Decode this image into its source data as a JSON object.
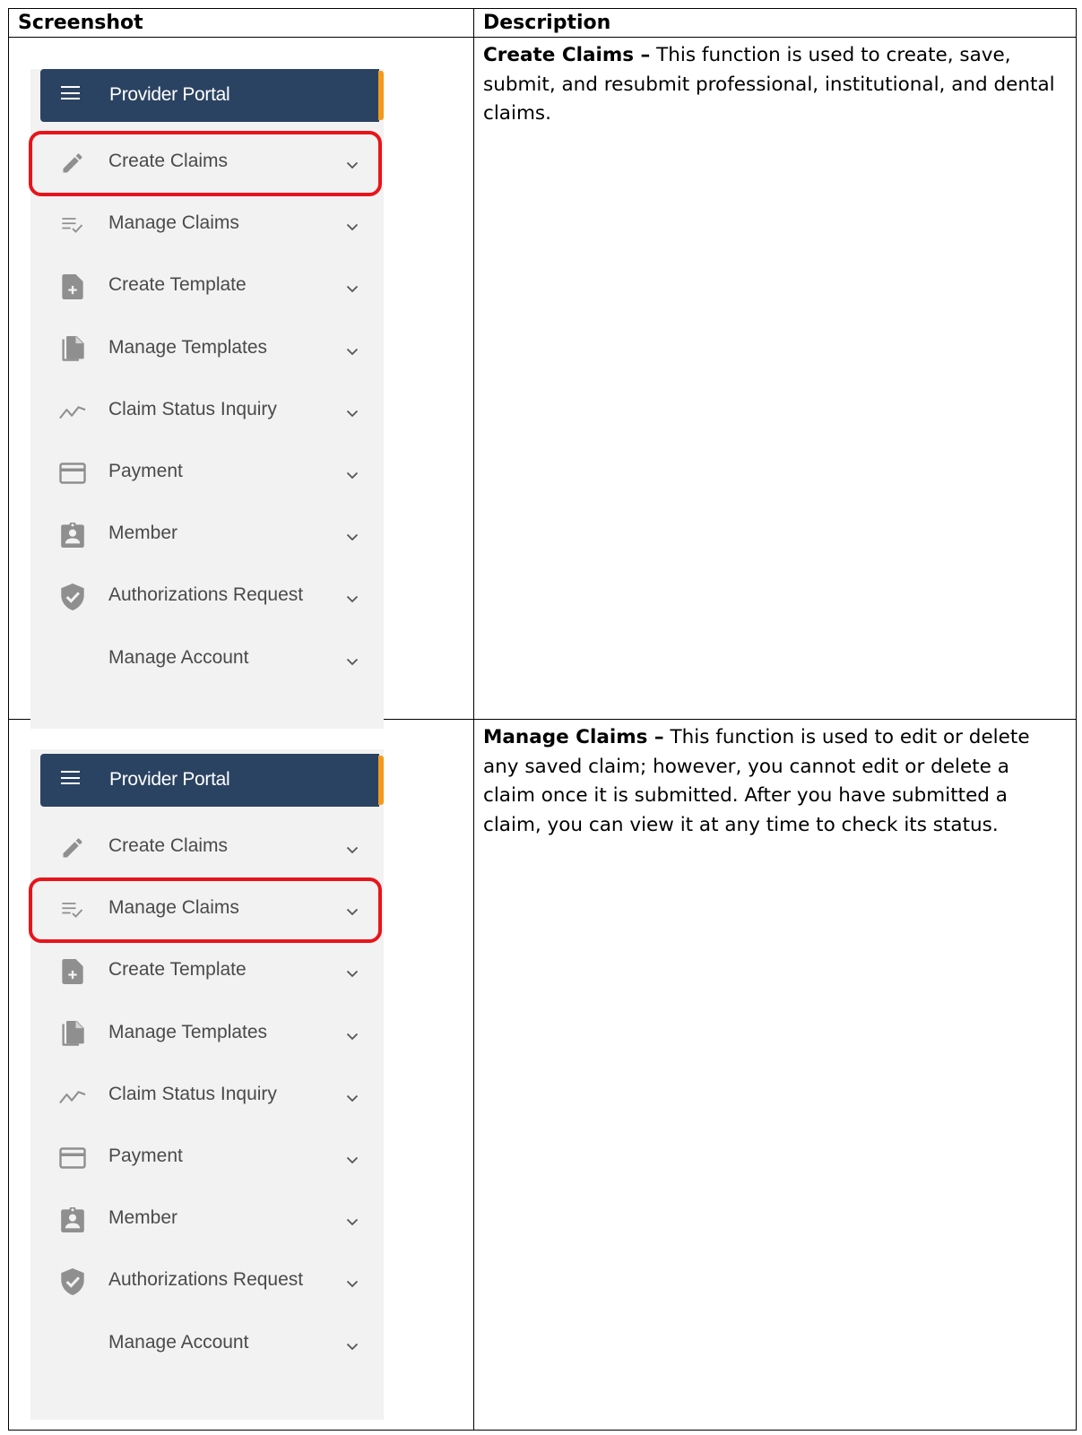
{
  "table": {
    "headers": [
      "Screenshot",
      "Description"
    ]
  },
  "sidebar": {
    "title": "Provider Portal",
    "items": [
      {
        "label": "Create Claims",
        "icon": "pencil-icon"
      },
      {
        "label": "Manage Claims",
        "icon": "list-check-icon"
      },
      {
        "label": "Create Template",
        "icon": "file-plus-icon"
      },
      {
        "label": "Manage Templates",
        "icon": "files-icon"
      },
      {
        "label": "Claim Status Inquiry",
        "icon": "trend-line-icon"
      },
      {
        "label": "Payment",
        "icon": "credit-card-icon"
      },
      {
        "label": "Member",
        "icon": "id-badge-icon"
      },
      {
        "label": "Authorizations Request",
        "icon": "shield-check-icon"
      },
      {
        "label": "Manage Account",
        "icon": ""
      }
    ]
  },
  "rows": [
    {
      "highlighted_item": "Create Claims",
      "title": "Create Claims –",
      "text": " This function is used to create, save, submit, and resubmit professional, institutional, and dental claims."
    },
    {
      "highlighted_item": "Manage Claims",
      "title": "Manage Claims –",
      "text": " This function is used to edit or delete any saved claim; however, you cannot edit or delete a claim once it is submitted. After you have submitted a claim, you can view it at any time to check its status."
    }
  ],
  "colors": {
    "portal_bar": "#2b4362",
    "accent": "#f39a1e",
    "highlight": "#e8141b",
    "panel_bg": "#f2f2f2",
    "icon": "#8f8f8f"
  }
}
